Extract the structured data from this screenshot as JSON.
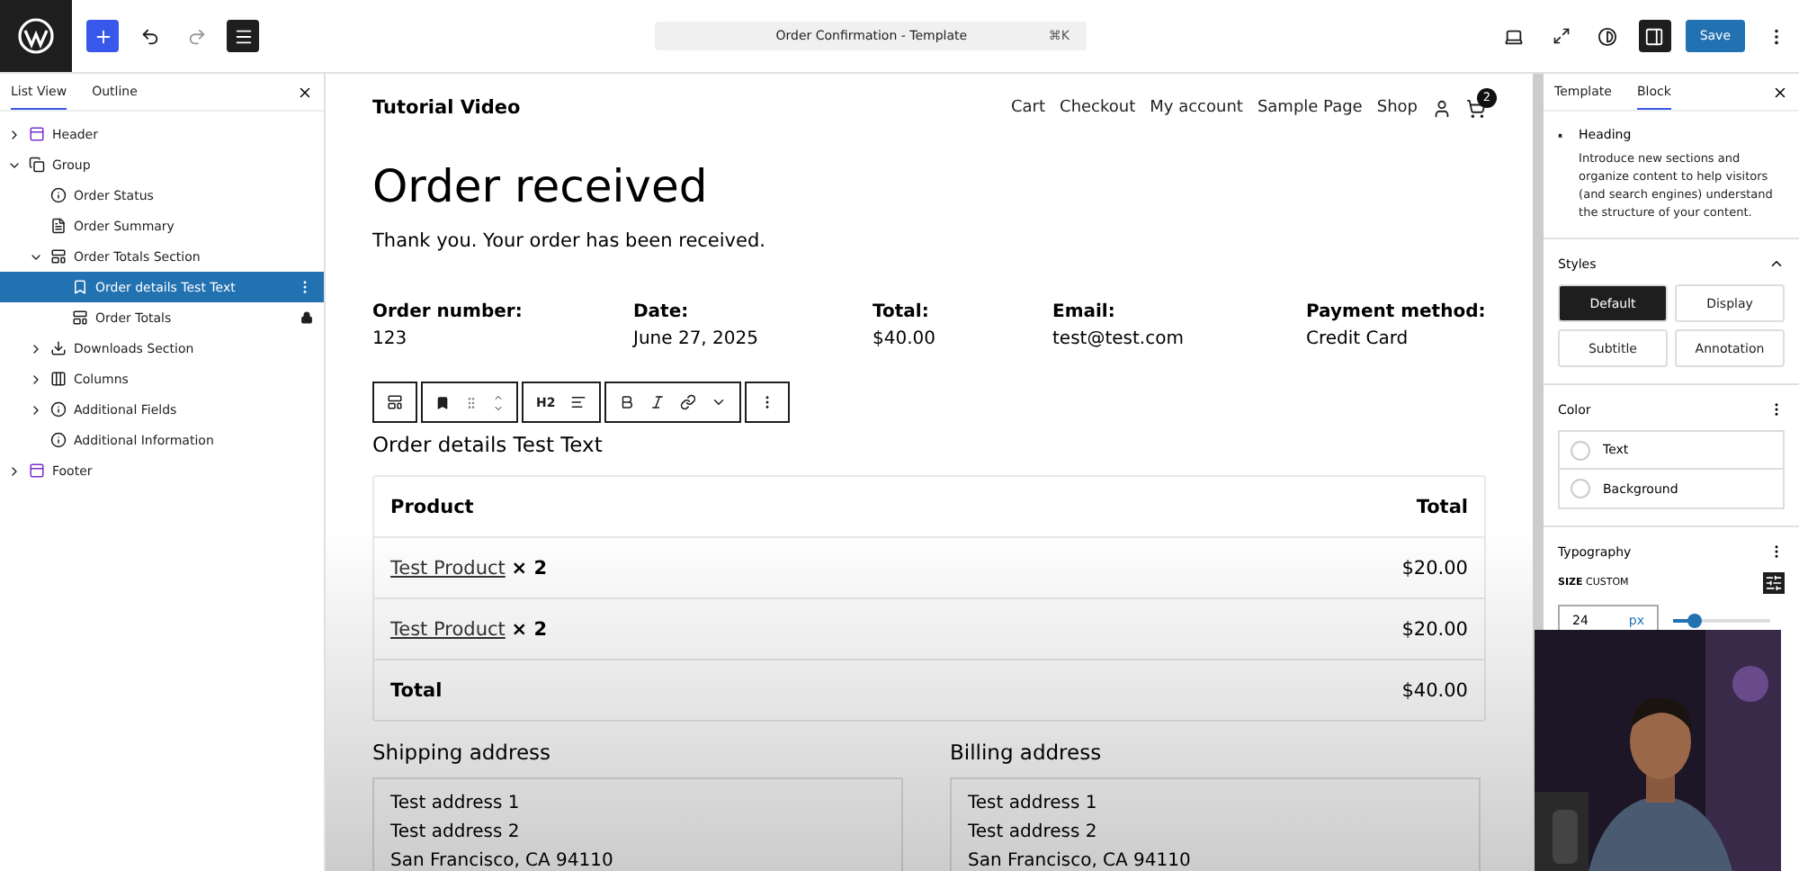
{
  "topbar": {
    "title": "Order Confirmation - Template",
    "shortcut": "⌘K",
    "save": "Save"
  },
  "list_view": {
    "tabs": [
      {
        "label": "List View",
        "selected": true
      },
      {
        "label": "Outline",
        "selected": false
      }
    ],
    "items": [
      {
        "label": "Header",
        "kind": "part",
        "expanded": false,
        "selected": false
      },
      {
        "label": "Group",
        "kind": "group",
        "expanded": true,
        "selected": false,
        "children": [
          {
            "label": "Order Status",
            "kind": "info",
            "selected": false
          },
          {
            "label": "Order Summary",
            "kind": "summary",
            "selected": false
          },
          {
            "label": "Order Totals Section",
            "kind": "section",
            "expanded": true,
            "selected": false,
            "children": [
              {
                "label": "Order details Test Text",
                "kind": "heading",
                "selected": true
              },
              {
                "label": "Order Totals",
                "kind": "section",
                "selected": false,
                "locked": true
              }
            ]
          },
          {
            "label": "Downloads Section",
            "kind": "download",
            "expanded": false,
            "selected": false
          },
          {
            "label": "Columns",
            "kind": "columns",
            "expanded": false,
            "selected": false
          },
          {
            "label": "Additional Fields",
            "kind": "info",
            "expanded": false,
            "selected": false
          },
          {
            "label": "Additional Information",
            "kind": "info",
            "selected": false
          }
        ]
      },
      {
        "label": "Footer",
        "kind": "part",
        "expanded": false,
        "selected": false
      }
    ]
  },
  "canvas": {
    "site_title": "Tutorial Video",
    "nav": [
      "Cart",
      "Checkout",
      "My account",
      "Sample Page",
      "Shop"
    ],
    "cart_count": "2",
    "heading": "Order received",
    "thank_you": "Thank you. Your order has been received.",
    "details": [
      {
        "label": "Order number:",
        "value": "123"
      },
      {
        "label": "Date:",
        "value": "June 27, 2025"
      },
      {
        "label": "Total:",
        "value": "$40.00"
      },
      {
        "label": "Email:",
        "value": "test@test.com"
      },
      {
        "label": "Payment method:",
        "value": "Credit Card"
      }
    ],
    "toolbar": {
      "heading_level": "H2"
    },
    "selected_heading": "Order details Test Text",
    "table": {
      "columns": [
        "Product",
        "Total"
      ],
      "rows": [
        {
          "product": "Test Product",
          "qty": "× 2",
          "total": "$20.00"
        },
        {
          "product": "Test Product",
          "qty": "× 2",
          "total": "$20.00"
        }
      ],
      "footer": {
        "label": "Total",
        "value": "$40.00"
      }
    },
    "addresses": [
      {
        "title": "Shipping address",
        "lines": [
          "Test address 1",
          "Test address 2",
          "San Francisco, CA 94110"
        ]
      },
      {
        "title": "Billing address",
        "lines": [
          "Test address 1",
          "Test address 2",
          "San Francisco, CA 94110"
        ]
      }
    ]
  },
  "inspector": {
    "tabs": [
      {
        "label": "Template",
        "selected": false
      },
      {
        "label": "Block",
        "selected": true
      }
    ],
    "block": {
      "name": "Heading",
      "description": "Introduce new sections and organize content to help visitors (and search engines) understand the structure of your content."
    },
    "styles": {
      "title": "Styles",
      "options": [
        {
          "label": "Default",
          "selected": true
        },
        {
          "label": "Display",
          "selected": false
        },
        {
          "label": "Subtitle",
          "selected": false
        },
        {
          "label": "Annotation",
          "selected": false
        }
      ]
    },
    "color": {
      "title": "Color",
      "items": [
        "Text",
        "Background"
      ]
    },
    "typography": {
      "title": "Typography",
      "size_label": "SIZE",
      "size_mode": "CUSTOM",
      "value": "24",
      "unit": "px",
      "level": 0.22
    }
  }
}
